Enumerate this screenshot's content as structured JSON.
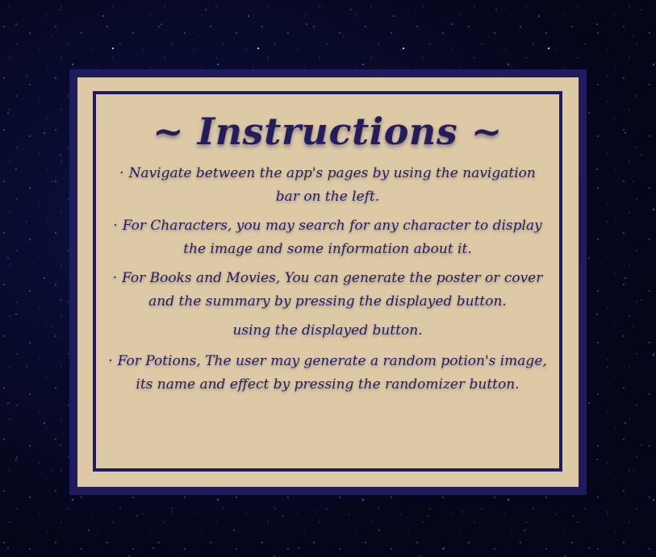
{
  "card": {
    "title": "~ Instructions ~",
    "items": [
      {
        "bullet": "·",
        "text": "Navigate between the app's pages by using the navigation bar on the left."
      },
      {
        "bullet": "·",
        "text": "For Characters, you may search for any character to display the image and some information about it."
      },
      {
        "bullet": "·",
        "text": "For Books and Movies, You can generate the poster or cover and the summary by pressing the displayed button."
      },
      {
        "bullet": "",
        "text": "using the displayed button."
      },
      {
        "bullet": "·",
        "text": "For Potions, The user may generate a random potion's image, its name and effect by pressing the randomizer button."
      }
    ]
  },
  "colors": {
    "card_background": "#ddc9a6",
    "frame_navy": "#1f1b5e",
    "text_navy": "#241d5c",
    "space_background": "#05061a"
  }
}
